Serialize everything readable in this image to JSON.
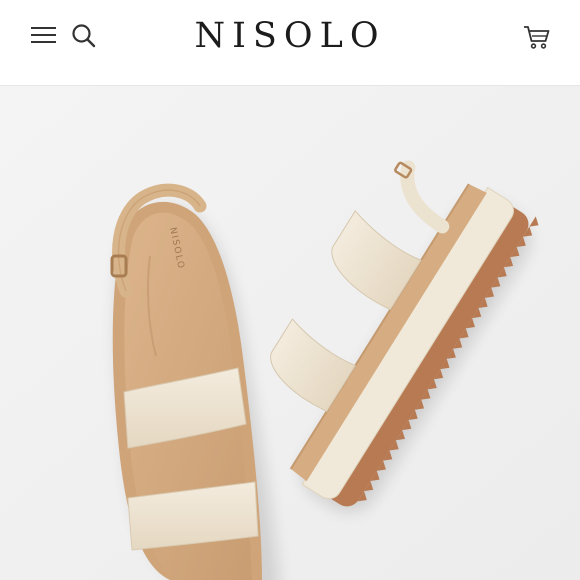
{
  "header": {
    "brand": "NISOLO",
    "menu_icon": "hamburger-menu-icon",
    "search_icon": "search-icon",
    "cart_icon": "shopping-cart-icon"
  },
  "product_image": {
    "insole_stamp": "NISOLO",
    "colors": {
      "background": "#f1f1f1",
      "strap": "#eee4d3",
      "footbed": "#d6ad83",
      "midsole": "#f0e8d8",
      "outsole": "#b77a52"
    }
  }
}
